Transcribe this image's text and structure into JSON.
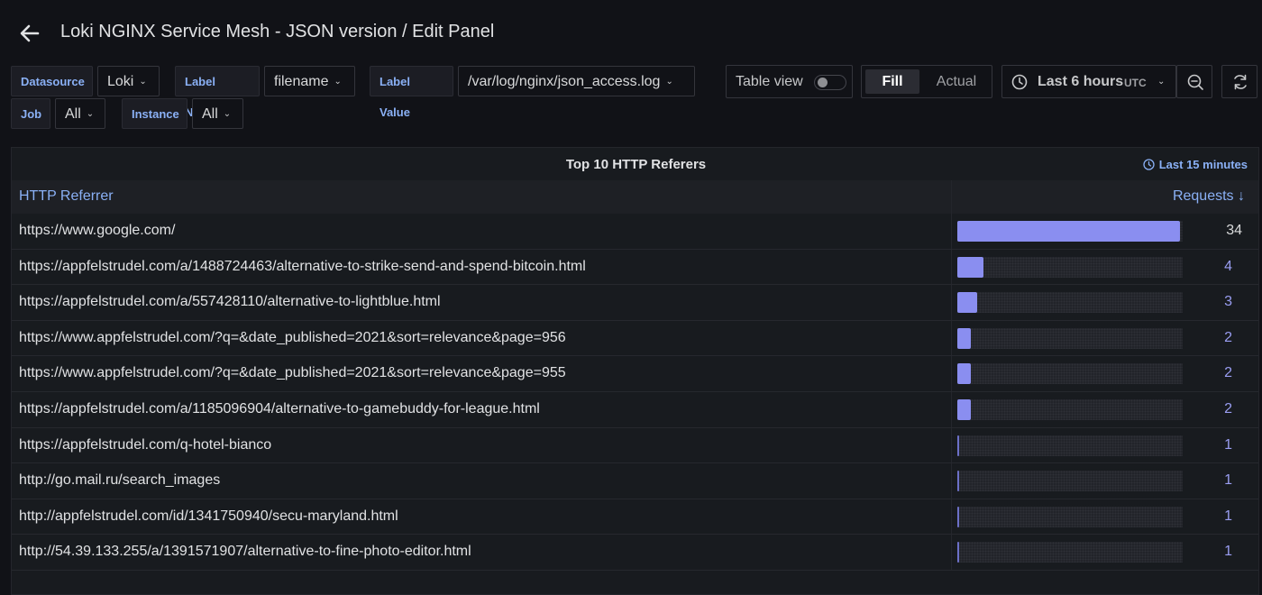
{
  "header": {
    "title": "Loki NGINX Service Mesh - JSON version / Edit Panel"
  },
  "variables": {
    "datasource_label": "Datasource",
    "datasource_value": "Loki",
    "label_name_label": "Label Name",
    "label_name_value": "filename",
    "label_value_label": "Label Value",
    "label_value_value": "/var/log/nginx/json_access.log",
    "job_label": "Job",
    "job_value": "All",
    "instance_label": "Instance",
    "instance_value": "All"
  },
  "toolbar": {
    "table_view_label": "Table view",
    "fill_label": "Fill",
    "actual_label": "Actual",
    "time_range": "Last 6 hours",
    "timezone": "UTC"
  },
  "panel": {
    "title": "Top 10 HTTP Referers",
    "time_override": "Last 15 minutes",
    "columns": {
      "referrer": "HTTP Referrer",
      "requests": "Requests ↓"
    },
    "max_requests": 34,
    "rows": [
      {
        "url": "https://www.google.com/",
        "requests": "34",
        "value": 34
      },
      {
        "url": "https://appfelstrudel.com/a/1488724463/alternative-to-strike-send-and-spend-bitcoin.html",
        "requests": "4",
        "value": 4
      },
      {
        "url": "https://appfelstrudel.com/a/557428110/alternative-to-lightblue.html",
        "requests": "3",
        "value": 3
      },
      {
        "url": "https://www.appfelstrudel.com/?q=&date_published=2021&sort=relevance&page=956",
        "requests": "2",
        "value": 2
      },
      {
        "url": "https://www.appfelstrudel.com/?q=&date_published=2021&sort=relevance&page=955",
        "requests": "2",
        "value": 2
      },
      {
        "url": "https://appfelstrudel.com/a/1185096904/alternative-to-gamebuddy-for-league.html",
        "requests": "2",
        "value": 2
      },
      {
        "url": "https://appfelstrudel.com/q-hotel-bianco",
        "requests": "1",
        "value": 1
      },
      {
        "url": "http://go.mail.ru/search_images",
        "requests": "1",
        "value": 1
      },
      {
        "url": "http://appfelstrudel.com/id/1341750940/secu-maryland.html",
        "requests": "1",
        "value": 1
      },
      {
        "url": "http://54.39.133.255/a/1391571907/alternative-to-fine-photo-editor.html",
        "requests": "1",
        "value": 1
      }
    ]
  },
  "colors": {
    "accent": "#8ab0f5",
    "bar": "#8a8ef0",
    "value_text": "#9a9ef2",
    "top_value_text": "#d8d9da",
    "background": "#111217",
    "panel_bg": "#181b1f"
  },
  "icons": [
    "arrow-left-icon",
    "chevron-down-icon",
    "clock-icon",
    "zoom-out-icon",
    "refresh-icon",
    "sort-down-arrow-icon"
  ]
}
